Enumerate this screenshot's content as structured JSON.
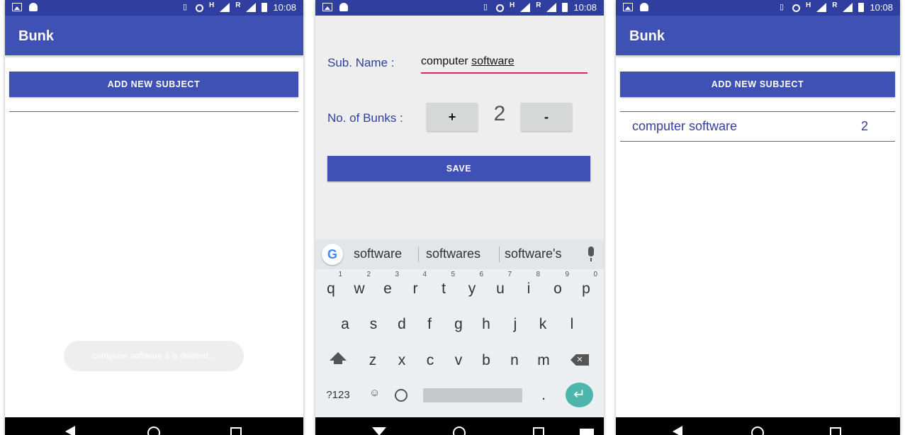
{
  "status_bar": {
    "time": "10:08",
    "net_h": "H",
    "net_r": "R"
  },
  "screen1": {
    "app_title": "Bunk",
    "add_button": "ADD NEW SUBJECT",
    "toast": "computer software 3 is deleted..."
  },
  "screen2": {
    "sub_name_label": "Sub. Name :",
    "sub_name_value_part1": "computer ",
    "sub_name_value_part2": "software",
    "bunks_label": "No. of Bunks :",
    "plus": "+",
    "count": "2",
    "minus": "-",
    "save_button": "SAVE",
    "keyboard": {
      "google": "G",
      "suggestions": [
        "software",
        "softwares",
        "software's"
      ],
      "row1": [
        "q",
        "w",
        "e",
        "r",
        "t",
        "y",
        "u",
        "i",
        "o",
        "p"
      ],
      "row1_hints": [
        "1",
        "2",
        "3",
        "4",
        "5",
        "6",
        "7",
        "8",
        "9",
        "0"
      ],
      "row2": [
        "a",
        "s",
        "d",
        "f",
        "g",
        "h",
        "j",
        "k",
        "l"
      ],
      "row3": [
        "z",
        "x",
        "c",
        "v",
        "b",
        "n",
        "m"
      ],
      "symbols": "?123",
      "emoji": "☺",
      "period": ".",
      "enter": "↵",
      "delete": "✕"
    }
  },
  "screen3": {
    "app_title": "Bunk",
    "add_button": "ADD NEW SUBJECT",
    "rows": [
      {
        "subject": "computer software",
        "bunks": "2"
      }
    ]
  },
  "colors": {
    "primary": "#3f51b5",
    "primary_dark": "#303f9f",
    "accent": "#e91e63",
    "enter": "#4db6ac"
  }
}
